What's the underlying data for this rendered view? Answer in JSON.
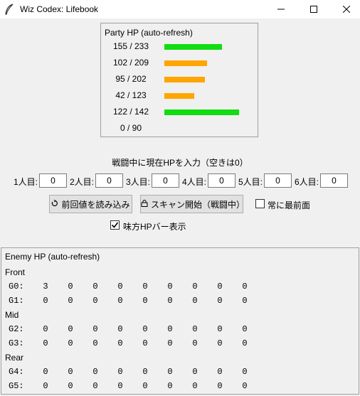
{
  "window": {
    "title": "Wiz Codex: Lifebook",
    "icon": "feather-icon",
    "controls": [
      "minimize-icon",
      "maximize-icon",
      "close-icon"
    ]
  },
  "party": {
    "title": "Party HP (auto-refresh)",
    "rows": [
      {
        "text": "155 / 233",
        "fraction": 0.665,
        "color": "#11dd11"
      },
      {
        "text": "102 / 209",
        "fraction": 0.488,
        "color": "#ffa500"
      },
      {
        "text": "95 / 202",
        "fraction": 0.47,
        "color": "#ffa500"
      },
      {
        "text": "42 / 123",
        "fraction": 0.341,
        "color": "#ffa500"
      },
      {
        "text": "122 / 142",
        "fraction": 0.859,
        "color": "#11dd11"
      },
      {
        "text": "0 / 90",
        "fraction": 0,
        "color": ""
      }
    ]
  },
  "instructions": "戦闘中に現在HPを入力（空きは0）",
  "slots": [
    {
      "label": "1人目:",
      "value": "0"
    },
    {
      "label": "2人目:",
      "value": "0"
    },
    {
      "label": "3人目:",
      "value": "0"
    },
    {
      "label": "4人目:",
      "value": "0"
    },
    {
      "label": "5人目:",
      "value": "0"
    },
    {
      "label": "6人目:",
      "value": "0"
    }
  ],
  "buttons": {
    "load_label": "前回値を読み込み",
    "load_icon": "refresh-icon",
    "scan_label": "スキャン開始（戦闘中）",
    "scan_icon": "lock-icon"
  },
  "checkboxes": {
    "always_on_top": {
      "label": "常に最前面",
      "checked": false
    },
    "ally_hp_bar": {
      "label": "味方HPバー表示",
      "checked": true
    }
  },
  "enemy": {
    "title": "Enemy HP (auto-refresh)",
    "groups": [
      {
        "name": "Front",
        "rows": [
          {
            "label": "G0:",
            "values": [
              "3",
              "0",
              "0",
              "0",
              "0",
              "0",
              "0",
              "0",
              "0"
            ]
          },
          {
            "label": "G1:",
            "values": [
              "0",
              "0",
              "0",
              "0",
              "0",
              "0",
              "0",
              "0",
              "0"
            ]
          }
        ]
      },
      {
        "name": "Mid",
        "rows": [
          {
            "label": "G2:",
            "values": [
              "0",
              "0",
              "0",
              "0",
              "0",
              "0",
              "0",
              "0",
              "0"
            ]
          },
          {
            "label": "G3:",
            "values": [
              "0",
              "0",
              "0",
              "0",
              "0",
              "0",
              "0",
              "0",
              "0"
            ]
          }
        ]
      },
      {
        "name": "Rear",
        "rows": [
          {
            "label": "G4:",
            "values": [
              "0",
              "0",
              "0",
              "0",
              "0",
              "0",
              "0",
              "0",
              "0"
            ]
          },
          {
            "label": "G5:",
            "values": [
              "0",
              "0",
              "0",
              "0",
              "0",
              "0",
              "0",
              "0",
              "0"
            ]
          }
        ]
      }
    ]
  }
}
